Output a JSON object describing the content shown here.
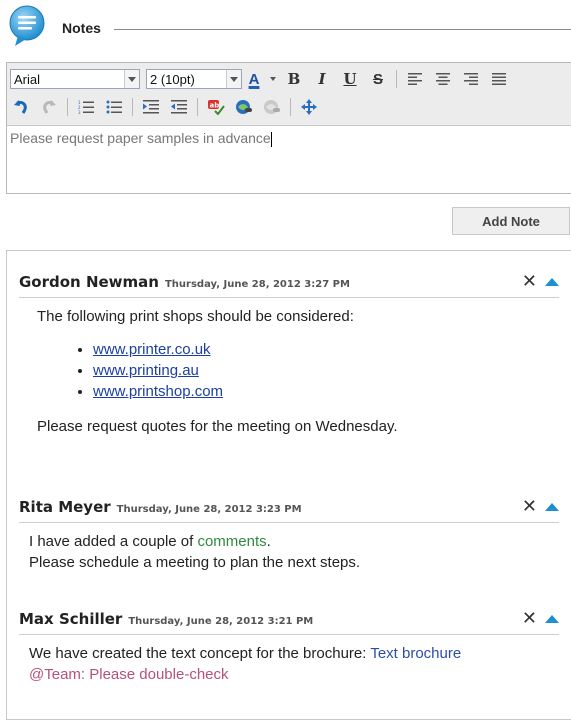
{
  "header": {
    "title": "Notes"
  },
  "editor": {
    "font_value": "Arial",
    "size_value": "2 (10pt)",
    "bold_label": "B",
    "italic_label": "I",
    "underline_label": "U",
    "strike_label": "S",
    "font_color_label": "A",
    "text": "Please request paper samples in advance"
  },
  "add_note_label": "Add Note",
  "notes": [
    {
      "author": "Gordon Newman",
      "date": "Thursday, June 28, 2012 3:27 PM",
      "intro": "The following print shops should be considered:",
      "links": [
        "www.printer.co.uk",
        "www.printing.au",
        "www.printshop.com"
      ],
      "outro": "Please request quotes for the meeting on Wednesday."
    },
    {
      "author": "Rita Meyer",
      "date": "Thursday, June 28, 2012 3:23 PM",
      "line1_pre": "I have added a couple of ",
      "line1_kw": "comments",
      "line1_post": ".",
      "line2": "Please schedule a meeting to plan the next steps."
    },
    {
      "author": "Max Schiller",
      "date": "Thursday, June 28, 2012 3:21 PM",
      "pre": "We have created the text concept for the brochure: ",
      "link": "Text brochure",
      "mention": "@Team: Please double-check"
    }
  ],
  "colors": {
    "accent": "#1e8fd0",
    "mention": "#b3527c",
    "keyword": "#2e8a3e"
  },
  "icons": {
    "close": "✕"
  }
}
